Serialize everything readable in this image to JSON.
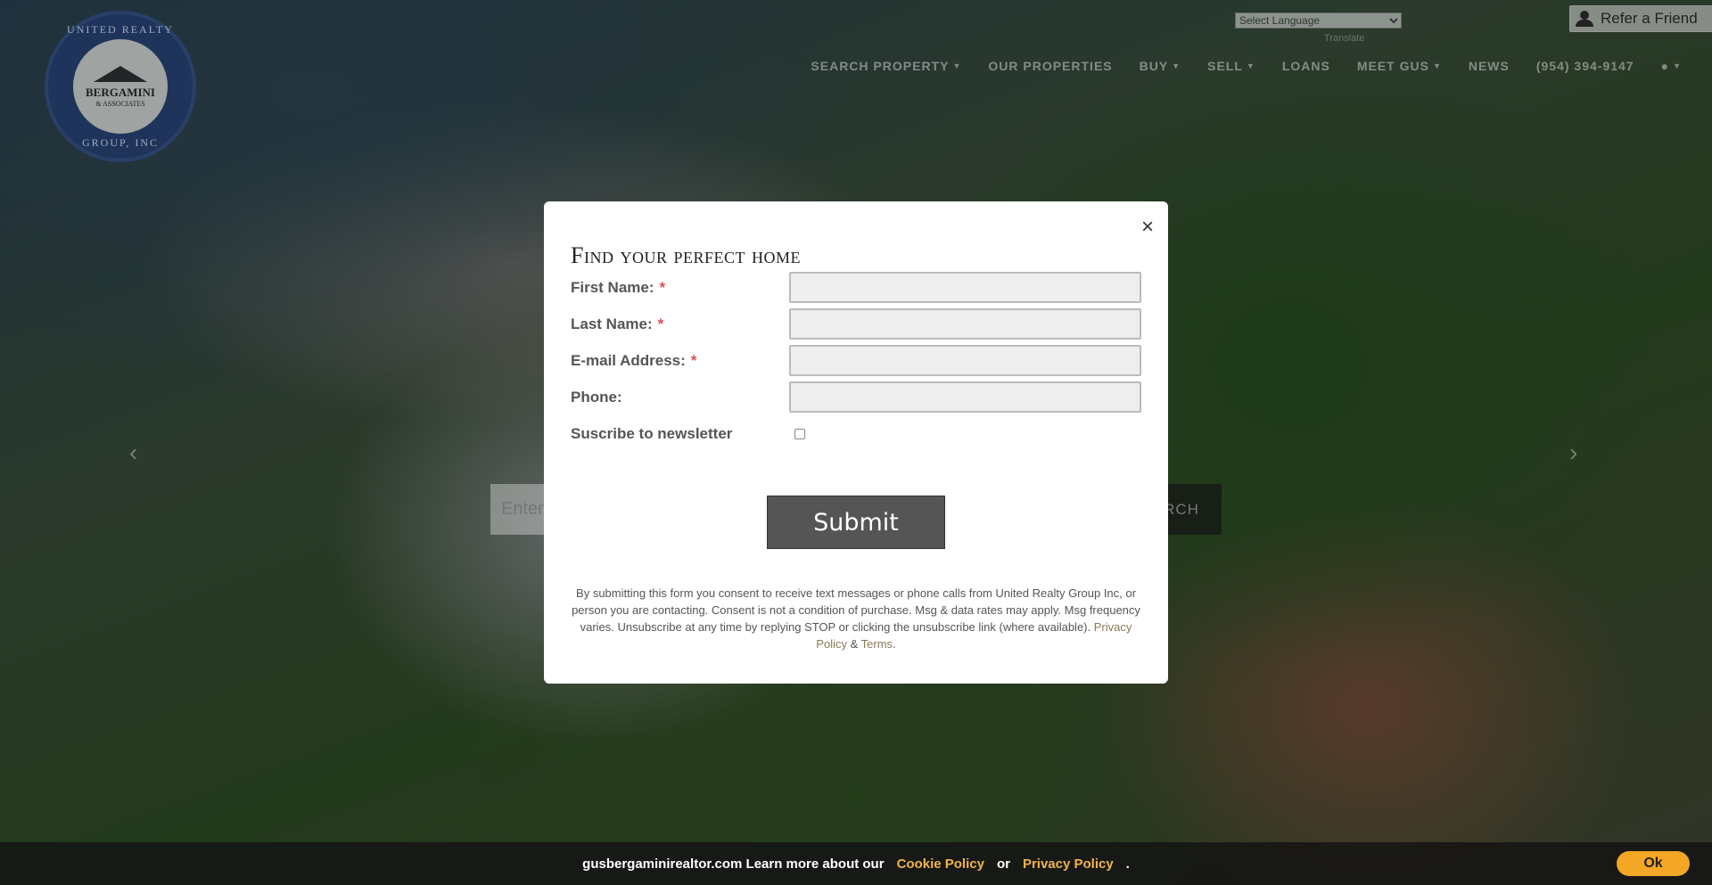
{
  "header": {
    "logo_ring_top": "UNITED REALTY",
    "logo_name": "BERGAMINI",
    "logo_sub": "& ASSOCIATES",
    "logo_ring_bottom": "GROUP, INC",
    "language_select": "Select Language",
    "translate_label": "Translate",
    "refer_label": "Refer a Friend"
  },
  "nav": {
    "items": [
      {
        "label": "SEARCH PROPERTY",
        "has_caret": true
      },
      {
        "label": "OUR PROPERTIES",
        "has_caret": false
      },
      {
        "label": "BUY",
        "has_caret": true
      },
      {
        "label": "SELL",
        "has_caret": true
      },
      {
        "label": "LOANS",
        "has_caret": false
      },
      {
        "label": "MEET GUS",
        "has_caret": true
      },
      {
        "label": "NEWS",
        "has_caret": false
      },
      {
        "label": "(954) 394-9147",
        "has_caret": false
      }
    ],
    "user_icon": "user-icon"
  },
  "hero": {
    "search_placeholder": "Enter",
    "search_button": "RCH",
    "arrow_left": "‹",
    "arrow_right": "›"
  },
  "modal": {
    "close": "×",
    "title": "Find your perfect home",
    "fields": {
      "first_name": "First Name:",
      "last_name": "Last Name:",
      "email": "E-mail Address:",
      "phone": "Phone:",
      "newsletter": "Suscribe to newsletter"
    },
    "required_mark": "*",
    "submit": "Submit",
    "disclaimer": "By submitting this form you consent to receive text messages or phone calls from United Realty Group Inc, or person you are contacting. Consent is not a condition of purchase. Msg & data rates may apply. Msg frequency varies. Unsubscribe at any time by replying STOP or clicking the unsubscribe link (where available).",
    "privacy_link": "Privacy Policy",
    "and": "&",
    "terms_link": "Terms",
    "period": "."
  },
  "cookie": {
    "text": "gusbergaminirealtor.com Learn more about our",
    "cookie_policy": "Cookie Policy",
    "or": "or",
    "privacy_policy": "Privacy Policy",
    "period": ".",
    "ok": "Ok"
  },
  "colors": {
    "accent": "#f4a625",
    "link": "#f2b34a",
    "required": "#d9534f",
    "submit_bg": "#555555"
  }
}
